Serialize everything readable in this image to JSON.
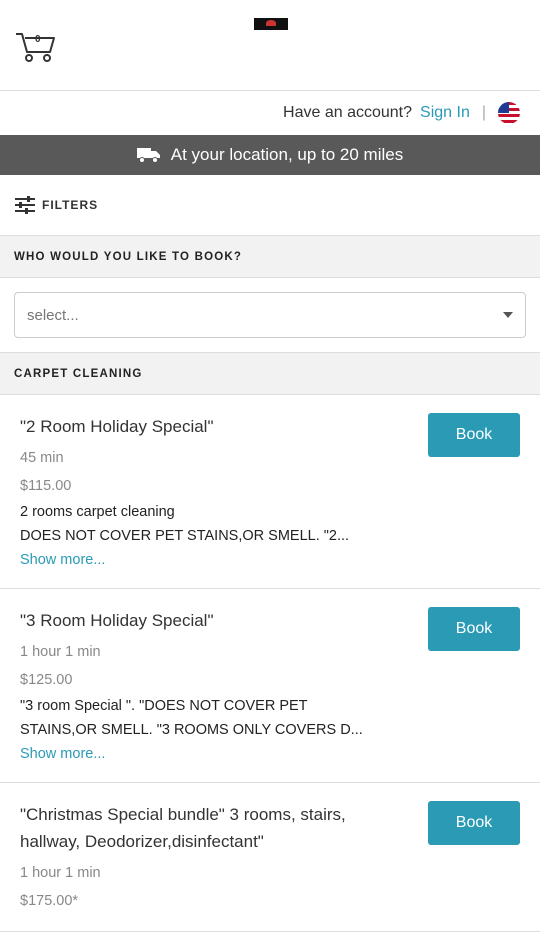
{
  "header": {
    "cart_count": "0"
  },
  "account": {
    "question": "Have an account?",
    "sign_in": "Sign In",
    "separator": "|"
  },
  "location_bar": {
    "text": "At your location, up to 20 miles"
  },
  "filters": {
    "label": "FILTERS"
  },
  "booking": {
    "heading": "WHO WOULD YOU LIKE TO BOOK?",
    "select_value": "select..."
  },
  "category": {
    "heading": "CARPET CLEANING"
  },
  "services": [
    {
      "title": "\"2 Room Holiday Special\"",
      "duration": "45 min",
      "price": "$115.00",
      "desc_line1": "2 rooms carpet cleaning",
      "desc_line2": "DOES NOT COVER PET STAINS,OR SMELL. \"2...",
      "more": "Show more...",
      "button": "Book"
    },
    {
      "title": "\"3 Room Holiday Special\"",
      "duration": "1 hour 1 min",
      "price": "$125.00",
      "desc_line1": "\"3 room Special \". \"DOES NOT COVER PET",
      "desc_line2": "STAINS,OR SMELL. \"3 ROOMS ONLY COVERS D...",
      "more": "Show more...",
      "button": "Book"
    },
    {
      "title": "\"Christmas Special bundle\" 3 rooms, stairs, hallway, Deodorizer,disinfectant\"",
      "duration": "1 hour 1 min",
      "price": "$175.00*",
      "button": "Book"
    }
  ],
  "colors": {
    "accent": "#2a9ab5",
    "location_bar": "#595959"
  }
}
